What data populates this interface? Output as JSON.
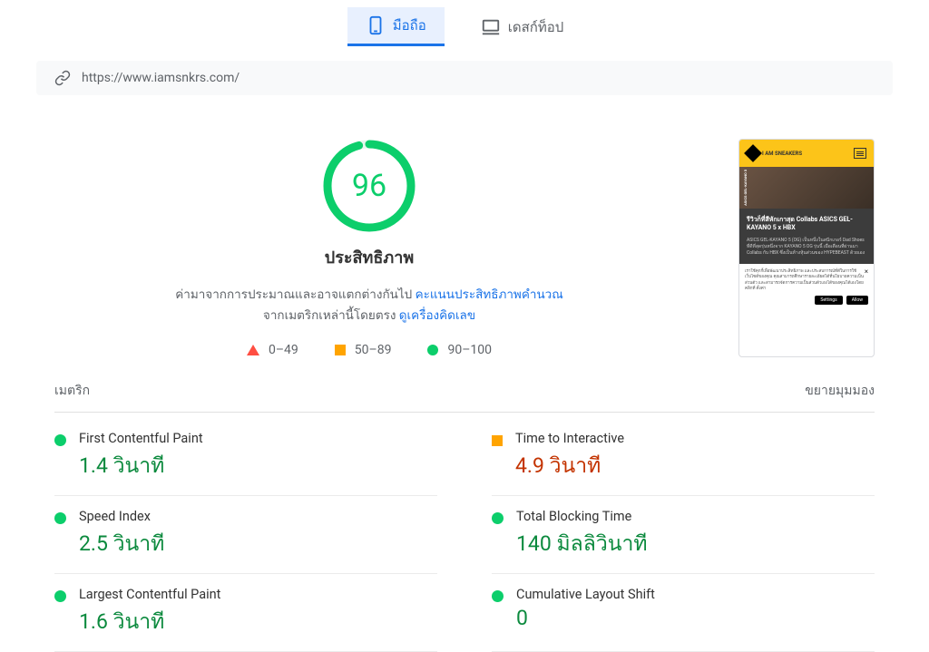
{
  "tabs": {
    "mobile": "มือถือ",
    "desktop": "เดสก์ท็อป"
  },
  "url": "https://www.iamsnkrs.com/",
  "score": "96",
  "performance_label": "ประสิทธิภาพ",
  "desc_prefix": "ค่ามาจากการประมาณและอาจแตกต่างกันไป ",
  "desc_link1": "คะแนนประสิทธิภาพคำนวณ",
  "desc_mid": "จากเมตริกเหล่านี้โดยตรง ",
  "desc_link2": "ดูเครื่องคิดเลข",
  "legend": {
    "fail": "0–49",
    "avg": "50–89",
    "pass": "90–100"
  },
  "preview": {
    "brand": "I AM SNEAKERS",
    "img_label": "ASICS GEL-KAYANO 5",
    "title": "รีวิวก็ที่สีหักเกาสุด Collabs ASICS GEL-KAYANO 5 x HBX",
    "body": "ASICS GEL-KAYANO 5 (OG) เป็นหนึ่งในสนีกเกอร์ Dad Shoes ที่ดีที่สุดรุ่นหนึ่งจาก KAYANO 5 OG รุ่นนี้ เมื่อเดือนที่ผ่านมา Collabs กับ HBX ซึ่งเป็นห้างหุ้นส่วนของ HYPEBEAST ด้วยเอง",
    "cookie": "เราใช้คุกกี้เพื่อพัฒนาประสิทธิภาพ และประสบการณ์ที่ดีในการใช้เว็บไซต์ของคุณ คุณสามารถศึกษารายละเอียดได้ที่นโยบายความเป็นส่วนตัว และสามารถจัดการความเป็นส่วนตัวเองได้ของคุณได้เองโดยคลิกที่ ตั้งค่า",
    "settings": "Settings",
    "allow": "Allow"
  },
  "metrics_header": {
    "label": "เมตริก",
    "expand": "ขยายมุมมอง"
  },
  "metrics": [
    {
      "label": "First Contentful Paint",
      "value": "1.4 วินาที",
      "status": "green"
    },
    {
      "label": "Time to Interactive",
      "value": "4.9 วินาที",
      "status": "orange"
    },
    {
      "label": "Speed Index",
      "value": "2.5 วินาที",
      "status": "green"
    },
    {
      "label": "Total Blocking Time",
      "value": "140 มิลลิวินาที",
      "status": "green"
    },
    {
      "label": "Largest Contentful Paint",
      "value": "1.6 วินาที",
      "status": "green"
    },
    {
      "label": "Cumulative Layout Shift",
      "value": "0",
      "status": "green"
    }
  ]
}
